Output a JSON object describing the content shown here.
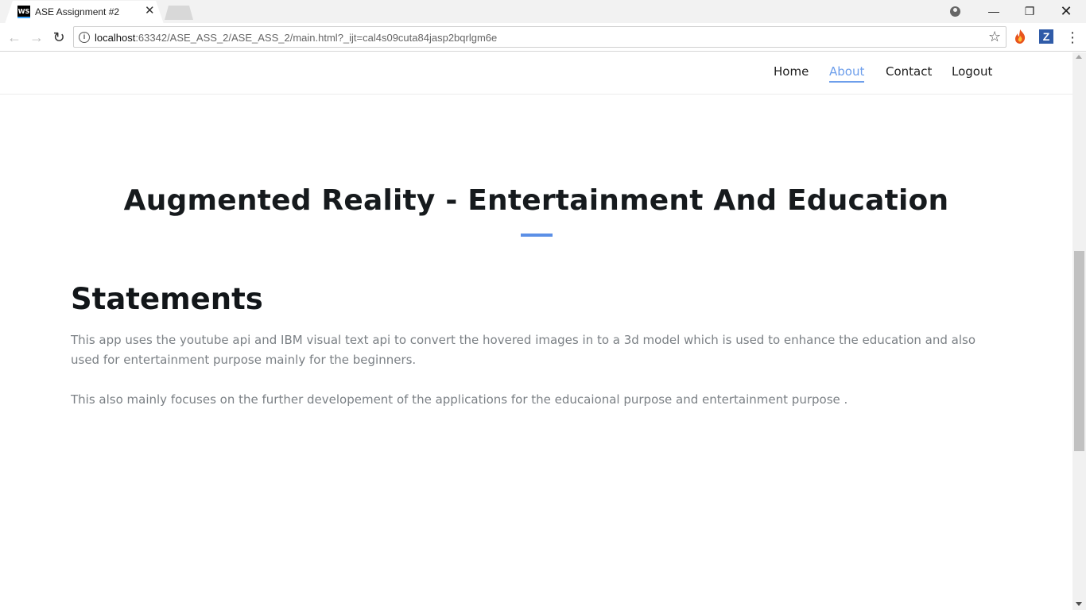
{
  "browser": {
    "tab_title": "ASE Assignment #2",
    "tab_favicon_text": "WS",
    "tab_close": "×",
    "url_host": "localhost",
    "url_rest": ":63342/ASE_ASS_2/ASE_ASS_2/main.html?_ijt=cal4s09cuta84jasp2bqrlgm6e",
    "icons": {
      "back": "←",
      "forward": "→",
      "reload": "↻",
      "info": "i",
      "star": "☆",
      "menu": "⋮",
      "minimize": "—",
      "maximize": "❐",
      "close": "✕",
      "extension_z": "Z"
    }
  },
  "nav": {
    "items": [
      {
        "label": "Home"
      },
      {
        "label": "About",
        "active": true
      },
      {
        "label": "Contact"
      },
      {
        "label": "Logout"
      }
    ]
  },
  "hero": {
    "title": "Augmented Reality - Entertainment And Education"
  },
  "section": {
    "heading": "Statements",
    "paragraphs": [
      "This app uses the youtube api and IBM visual text api to convert the hovered images in to a 3d model which is used to enhance the education and also used for entertainment purpose mainly for the beginners.",
      "This also mainly focuses on the further developement of the applications for the educaional purpose and entertainment purpose ."
    ]
  },
  "colors": {
    "accent": "#6d9eeb",
    "heading": "#161a1d",
    "body_text": "#7b8085"
  }
}
